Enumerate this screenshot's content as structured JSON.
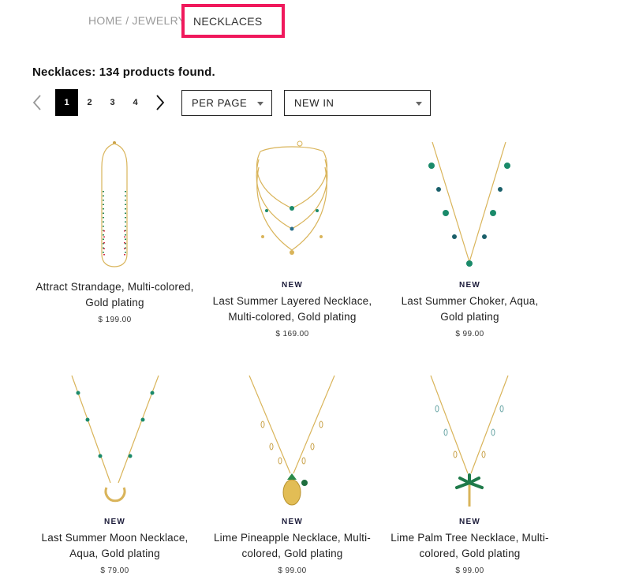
{
  "breadcrumb": {
    "home": "HOME",
    "sep": "/",
    "jewelry": "JEWELRY",
    "current": "NECKLACES"
  },
  "results_text": "Necklaces: 134 products found.",
  "pagination": {
    "pages": [
      "1",
      "2",
      "3",
      "4"
    ],
    "active": "1"
  },
  "per_page": {
    "label": "PER PAGE"
  },
  "sort": {
    "label": "NEW IN"
  },
  "products": [
    {
      "badge": "",
      "name_line1": "Attract Strandage, Multi-colored,",
      "name_line2": "Gold plating",
      "price": "$ 199.00"
    },
    {
      "badge": "NEW",
      "name_line1": "Last Summer Layered Necklace,",
      "name_line2": "Multi-colored, Gold plating",
      "price": "$ 169.00"
    },
    {
      "badge": "NEW",
      "name_line1": "Last Summer Choker, Aqua,",
      "name_line2": "Gold plating",
      "price": "$ 99.00"
    },
    {
      "badge": "NEW",
      "name_line1": "Last Summer Moon Necklace,",
      "name_line2": "Aqua, Gold plating",
      "price": "$ 79.00"
    },
    {
      "badge": "NEW",
      "name_line1": "Lime Pineapple Necklace, Multi-",
      "name_line2": "colored, Gold plating",
      "price": "$ 99.00"
    },
    {
      "badge": "NEW",
      "name_line1": "Lime Palm Tree Necklace, Multi-",
      "name_line2": "colored, Gold plating",
      "price": "$ 99.00"
    }
  ],
  "colors": {
    "highlight": "#f0195c",
    "gold": "#d9b45a",
    "green": "#1a8a6a",
    "text": "#222222"
  },
  "icons": [
    "chevron-left-icon",
    "chevron-right-icon",
    "caret-down-icon"
  ]
}
